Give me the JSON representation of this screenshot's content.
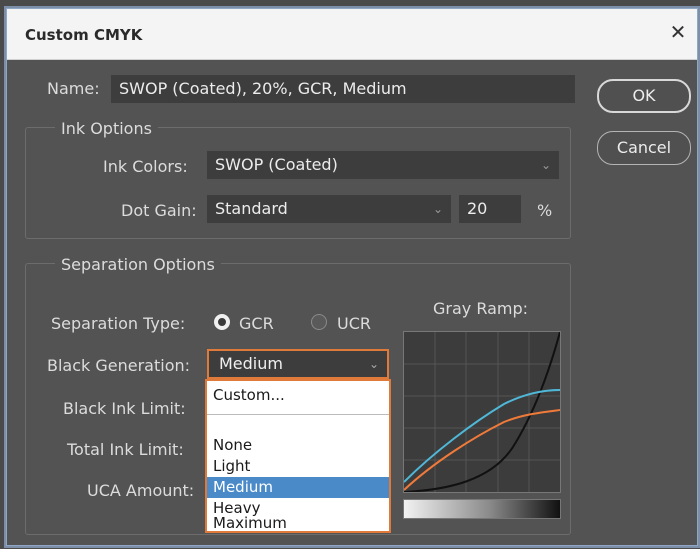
{
  "window": {
    "title": "Custom CMYK"
  },
  "name_field": {
    "label": "Name:",
    "value": "SWOP (Coated), 20%, GCR, Medium"
  },
  "buttons": {
    "ok": "OK",
    "cancel": "Cancel"
  },
  "ink_options": {
    "heading": "Ink Options",
    "ink_colors_label": "Ink Colors:",
    "ink_colors_value": "SWOP (Coated)",
    "dot_gain_label": "Dot Gain:",
    "dot_gain_value": "Standard",
    "dot_gain_amount": "20",
    "dot_gain_unit": "%"
  },
  "separation_options": {
    "heading": "Separation Options",
    "separation_type_label": "Separation Type:",
    "gcr_label": "GCR",
    "ucr_label": "UCR",
    "selected_type": "GCR",
    "black_generation_label": "Black Generation:",
    "black_generation_value": "Medium",
    "black_ink_limit_label": "Black Ink Limit:",
    "total_ink_limit_label": "Total Ink Limit:",
    "uca_amount_label": "UCA Amount:",
    "gray_ramp_label": "Gray Ramp:"
  },
  "black_generation_menu": {
    "items": [
      "Custom...",
      "None",
      "Light",
      "Medium",
      "Heavy",
      "Maximum"
    ],
    "selected": "Medium"
  },
  "colors": {
    "dialog_bg": "#535353",
    "highlight": "#e07a3a",
    "selection": "#4a8ac9",
    "ramp_cyan": "#4fb8d8",
    "ramp_orange": "#f07a3a",
    "ramp_black": "#111111"
  }
}
